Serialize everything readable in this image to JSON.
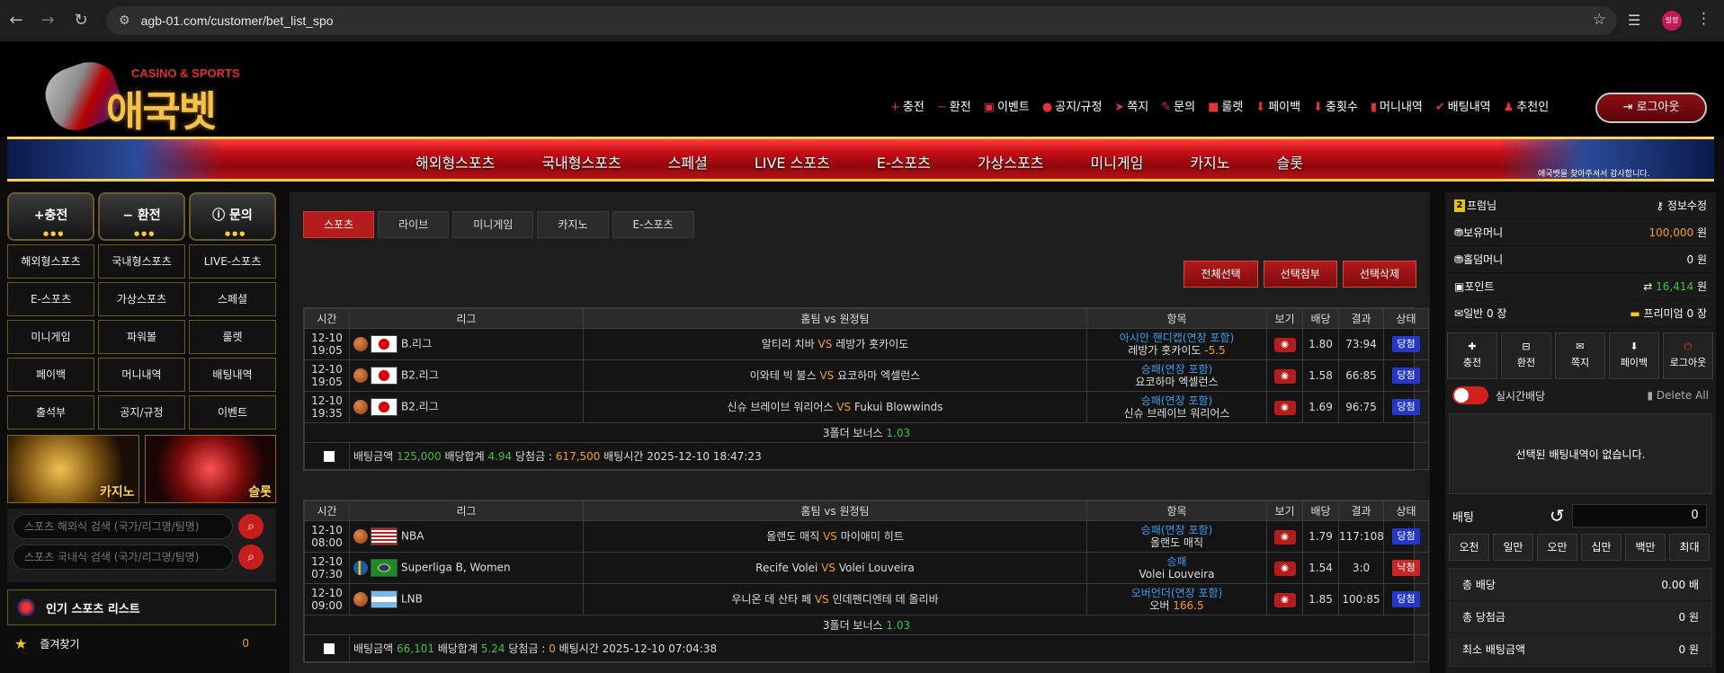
{
  "browser": {
    "url": "agb-01.com/customer/bet_list_spo",
    "profile_label": "설정"
  },
  "logo": {
    "tagline": "CASINO & SPORTS",
    "name": "애국벳",
    "badge": "Korea"
  },
  "top_menu": [
    {
      "icon": "plus-icon",
      "label": "충전"
    },
    {
      "icon": "minus-icon",
      "label": "환전"
    },
    {
      "icon": "calendar-icon",
      "label": "이벤트"
    },
    {
      "icon": "alert-icon",
      "label": "공지/규정"
    },
    {
      "icon": "paper-plane-icon",
      "label": "쪽지"
    },
    {
      "icon": "edit-icon",
      "label": "문의"
    },
    {
      "icon": "gift-icon",
      "label": "룰렛"
    },
    {
      "icon": "payback-icon",
      "label": "페이백"
    },
    {
      "icon": "payback-icon",
      "label": "충횟수"
    },
    {
      "icon": "trash-icon",
      "label": "머니내역"
    },
    {
      "icon": "check-icon",
      "label": "배팅내역"
    },
    {
      "icon": "users-icon",
      "label": "추천인"
    }
  ],
  "logout_top": "로그아웃",
  "main_nav": [
    "해외형스포츠",
    "국내형스포츠",
    "스페셜",
    "LIVE 스포츠",
    "E-스포츠",
    "가상스포츠",
    "미니게임",
    "카지노",
    "슬롯"
  ],
  "banner_note": "애국벳을 찾아주셔서 감사합니다.",
  "left": {
    "big_buttons": [
      "충전",
      "환전",
      "문의"
    ],
    "grid": [
      "해외형스포츠",
      "국내형스포츠",
      "LIVE-스포츠",
      "E-스포츠",
      "가상스포츠",
      "스페셜",
      "미니게임",
      "파워볼",
      "룰렛",
      "페이백",
      "머니내역",
      "배팅내역",
      "출석부",
      "공지/규정",
      "이벤트"
    ],
    "promos": [
      "카지노",
      "슬롯"
    ],
    "search1_placeholder": "스포츠 해외식 검색 (국가/리그명/팀명)",
    "search2_placeholder": "스포츠 국내식 검색 (국가/리그명/팀명)",
    "popular_title": "인기 스포츠 리스트",
    "favorites_label": "즐겨찾기",
    "favorites_count": "0"
  },
  "tabs": [
    "스포츠",
    "라이브",
    "미니게임",
    "카지노",
    "E-스포츠"
  ],
  "actions": [
    "전체선택",
    "선택첨부",
    "선택삭제"
  ],
  "columns": [
    "시간",
    "리그",
    "홈팀 vs 원정팀",
    "항목",
    "보기",
    "배당",
    "결과",
    "상태"
  ],
  "bets": [
    {
      "rows": [
        {
          "date": "12-10",
          "time": "19:05",
          "flag": "jp",
          "league": "B.리그",
          "home": "알티리 치바",
          "away": "레방가 홋카이도",
          "pick_type": "아시안 핸디캡(연장 포함)",
          "pick": "레방가 홋카이도",
          "pick_extra": "-5.5",
          "odds": "1.80",
          "result": "73:94",
          "status": "당첨",
          "status_type": "win"
        },
        {
          "date": "12-10",
          "time": "19:05",
          "flag": "jp",
          "league": "B2.리그",
          "home": "이와테 빅 불스",
          "away": "요코하마 엑셀런스",
          "pick_type": "승패(연장 포함)",
          "pick": "요코하마 엑셀런스",
          "pick_extra": "",
          "odds": "1.58",
          "result": "66:85",
          "status": "당첨",
          "status_type": "win"
        },
        {
          "date": "12-10",
          "time": "19:35",
          "flag": "jp",
          "league": "B2.리그",
          "home": "신슈 브레이브 워리어스",
          "away": "Fukui Blowwinds",
          "pick_type": "승패(연장 포함)",
          "pick": "신슈 브레이브 워리어스",
          "pick_extra": "",
          "odds": "1.69",
          "result": "96:75",
          "status": "당첨",
          "status_type": "win"
        }
      ],
      "bonus_label": "3폴더 보너스",
      "bonus_value": "1.03",
      "amount_label": "배팅금액",
      "amount": "125,000",
      "total_label": "배당합계",
      "total": "4.94",
      "win_label": "당첨금 :",
      "win": "617,500",
      "time_label": "배팅시간",
      "bet_time": "2025-12-10 18:47:23"
    },
    {
      "rows": [
        {
          "date": "12-10",
          "time": "08:00",
          "flag": "us",
          "league": "NBA",
          "home": "올랜도 매직",
          "away": "마이애미 히트",
          "pick_type": "승패(연장 포함)",
          "pick": "올랜도 매직",
          "pick_extra": "",
          "odds": "1.79",
          "result": "117:108",
          "status": "당첨",
          "status_type": "win"
        },
        {
          "date": "12-10",
          "time": "07:30",
          "flag": "br",
          "league": "Superliga B, Women",
          "home": "Recife Volei",
          "away": "Volei Louveira",
          "pick_type": "승패",
          "pick": "Volei Louveira",
          "pick_extra": "",
          "odds": "1.54",
          "result": "3:0",
          "status": "낙첨",
          "status_type": "lose"
        },
        {
          "date": "12-10",
          "time": "09:00",
          "flag": "ar",
          "league": "LNB",
          "home": "우니온 데 산타 페",
          "away": "인데펜디엔테 데 올리바",
          "pick_type": "오버언더(연장 포함)",
          "pick": "오버",
          "pick_extra": "166.5",
          "odds": "1.85",
          "result": "100:85",
          "status": "당첨",
          "status_type": "win"
        }
      ],
      "bonus_label": "3폴더 보너스",
      "bonus_value": "1.03",
      "amount_label": "배팅금액",
      "amount": "66,101",
      "total_label": "배당합계",
      "total": "5.24",
      "win_label": "당첨금 :",
      "win": "0",
      "time_label": "배팅시간",
      "bet_time": "2025-12-10 07:04:38"
    }
  ],
  "right": {
    "level": "2",
    "user": "프럼님",
    "edit_info": "정보수정",
    "money_label": "보유머니",
    "money": "100,000",
    "won": "원",
    "holdem_label": "홀덤머니",
    "holdem": "0",
    "point_label": "포인트",
    "point": "16,414",
    "coupon_normal": "일반 0 장",
    "coupon_premium": "프리미엄 0 장",
    "buttons": [
      "충전",
      "환전",
      "쪽지",
      "페이백",
      "로그아웃"
    ],
    "realtime_label": "실시간배당",
    "delete_all": "Delete All",
    "empty_msg": "선택된 배팅내역이 없습니다.",
    "bet_label": "배팅",
    "bet_amount": "0",
    "chips": [
      "오천",
      "일만",
      "오만",
      "십만",
      "백만",
      "최대"
    ],
    "totals": [
      {
        "label": "총 배당",
        "value": "0.00 배"
      },
      {
        "label": "총 당첨금",
        "value": "0 원"
      },
      {
        "label": "최소 배팅금액",
        "value": "0 원"
      }
    ]
  }
}
